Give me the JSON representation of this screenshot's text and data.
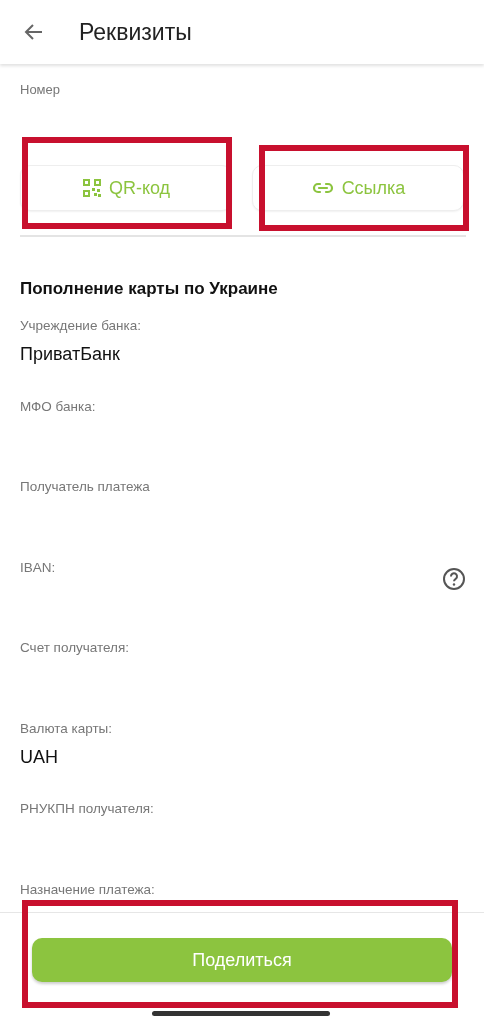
{
  "header": {
    "title": "Реквизиты"
  },
  "number_label": "Номер",
  "share_options": [
    {
      "label": "QR-код",
      "kind": "qr",
      "highlighted": true
    },
    {
      "label": "Ссылка",
      "kind": "link",
      "highlighted": true
    }
  ],
  "section": {
    "title": "Пополнение карты по Украине",
    "fields": [
      {
        "label": "Учреждение банка:",
        "value": "ПриватБанк",
        "help": false
      },
      {
        "label": "МФО банка:",
        "help": false
      },
      {
        "label": "Получатель платежа",
        "help": false
      },
      {
        "label": "IBAN:",
        "help": true
      },
      {
        "label": "Счет получателя:",
        "help": false
      },
      {
        "label": "Валюта карты:",
        "value": "UAH",
        "help": false
      },
      {
        "label": "РНУКПН получателя:",
        "help": false
      },
      {
        "label": "Назначение платежа:",
        "help": false
      }
    ]
  },
  "share_button": {
    "label": "Поделиться",
    "highlighted": true
  }
}
